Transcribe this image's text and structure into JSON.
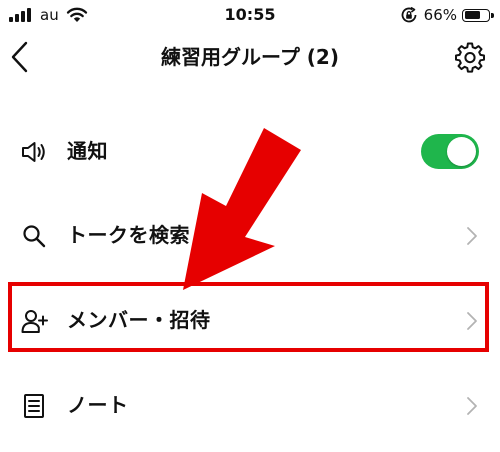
{
  "status_bar": {
    "carrier": "au",
    "time": "10:55",
    "battery_percent": "66%",
    "battery_level": 0.66
  },
  "header": {
    "title": "練習用グループ (2)",
    "back_icon": "chevron-left-icon",
    "settings_icon": "gear-icon"
  },
  "menu": {
    "items": [
      {
        "label": "通知",
        "icon": "speaker-icon",
        "control": "toggle",
        "toggle_on": true
      },
      {
        "label": "トークを検索",
        "icon": "search-icon",
        "control": "chevron"
      },
      {
        "label": "メンバー・招待",
        "icon": "add-member-icon",
        "control": "chevron",
        "highlighted": true
      },
      {
        "label": "ノート",
        "icon": "note-icon",
        "control": "chevron"
      }
    ]
  },
  "colors": {
    "toggle_on": "#1fb64c",
    "annotation": "#e60000",
    "chevron": "#b3b3b3",
    "text": "#111111"
  }
}
